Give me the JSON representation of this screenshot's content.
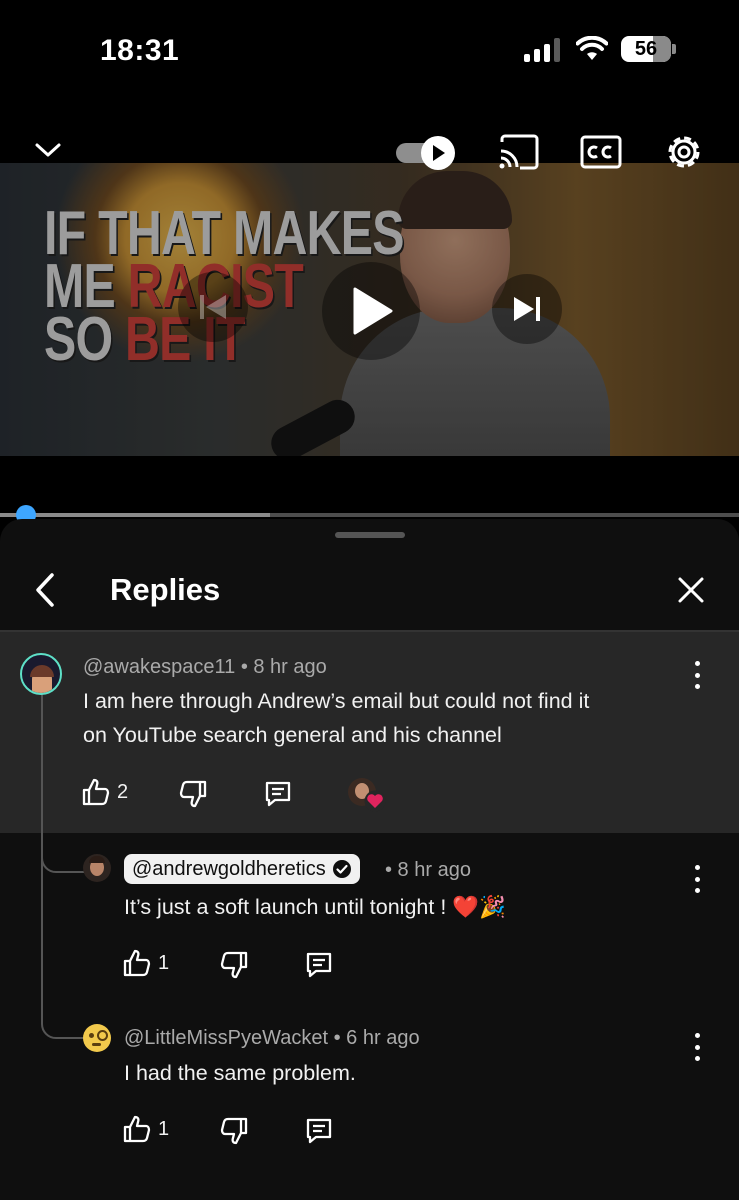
{
  "status_bar": {
    "time": "18:31",
    "battery": "56"
  },
  "player": {
    "thumbnail_text": {
      "line1": "IF THAT MAKES",
      "line2_white": "ME",
      "line2_red": "RACIST",
      "line3_white": "SO",
      "line3_red": "BE IT"
    },
    "icons": [
      "chevron-down-icon",
      "autoplay-toggle-icon",
      "cast-icon",
      "cc-icon",
      "settings-gear-icon",
      "previous-icon",
      "play-icon",
      "next-icon"
    ],
    "progress_fraction": 0.03,
    "buffer_fraction": 0.365
  },
  "sheet": {
    "title": "Replies"
  },
  "comments": [
    {
      "author": "@awakespace11",
      "time": "• 8 hr ago",
      "text_line1": "I am here through Andrew’s email but could not find it",
      "text_line2": "on YouTube search general and his channel",
      "likes": "2"
    },
    {
      "author": "@andrewgoldheretics",
      "time": "• 8 hr ago",
      "text": "It’s just a soft launch until tonight !",
      "emoji": "❤️🎉",
      "likes": "1",
      "verified": true
    },
    {
      "author": "@LittleMissPyeWacket",
      "time": "• 6 hr ago",
      "text": "I had the same problem.",
      "likes": "1"
    }
  ],
  "colors": {
    "accent_blue": "#3ea6ff",
    "sheet_bg": "#0f0f0f",
    "highlight_bg": "#272727",
    "heart_red": "#e0245e"
  }
}
